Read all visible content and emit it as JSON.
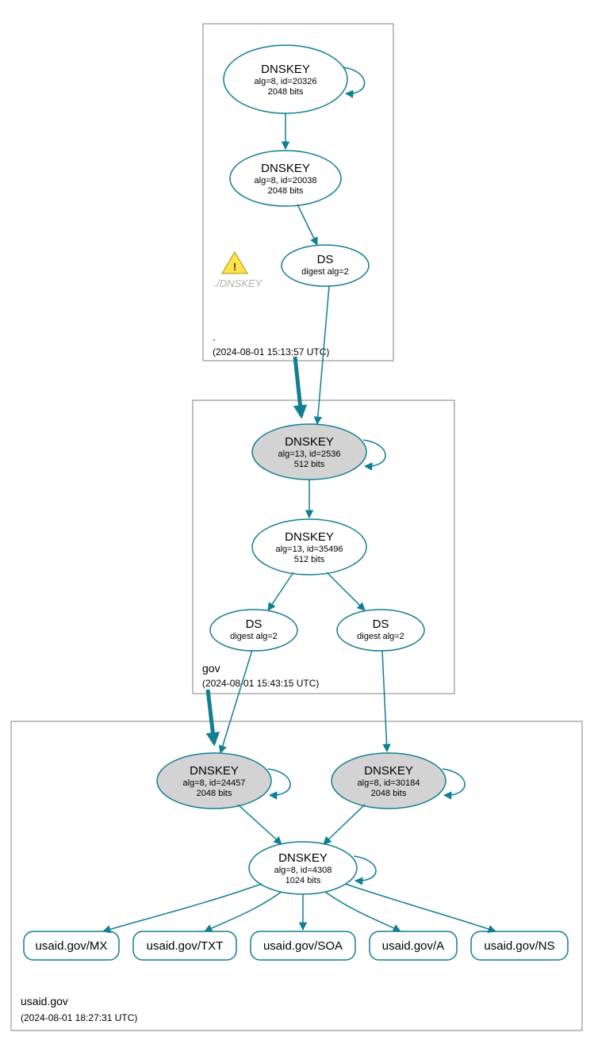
{
  "zones": {
    "root": {
      "name": ".",
      "timestamp": "(2024-08-01 15:13:57 UTC)",
      "nodes": {
        "key1": {
          "title": "DNSKEY",
          "line2": "alg=8, id=20326",
          "line3": "2048 bits"
        },
        "key2": {
          "title": "DNSKEY",
          "line2": "alg=8, id=20038",
          "line3": "2048 bits"
        },
        "ds": {
          "title": "DS",
          "line2": "digest alg=2"
        },
        "ghost": {
          "label": "./DNSKEY"
        }
      }
    },
    "gov": {
      "name": "gov",
      "timestamp": "(2024-08-01 15:43:15 UTC)",
      "nodes": {
        "key1": {
          "title": "DNSKEY",
          "line2": "alg=13, id=2536",
          "line3": "512 bits"
        },
        "key2": {
          "title": "DNSKEY",
          "line2": "alg=13, id=35496",
          "line3": "512 bits"
        },
        "ds1": {
          "title": "DS",
          "line2": "digest alg=2"
        },
        "ds2": {
          "title": "DS",
          "line2": "digest alg=2"
        }
      }
    },
    "usaid": {
      "name": "usaid.gov",
      "timestamp": "(2024-08-01 18:27:31 UTC)",
      "nodes": {
        "key1": {
          "title": "DNSKEY",
          "line2": "alg=8, id=24457",
          "line3": "2048 bits"
        },
        "key2": {
          "title": "DNSKEY",
          "line2": "alg=8, id=30184",
          "line3": "2048 bits"
        },
        "key3": {
          "title": "DNSKEY",
          "line2": "alg=8, id=4308",
          "line3": "1024 bits"
        },
        "rrset": {
          "mx": "usaid.gov/MX",
          "txt": "usaid.gov/TXT",
          "soa": "usaid.gov/SOA",
          "a": "usaid.gov/A",
          "ns": "usaid.gov/NS"
        }
      }
    }
  }
}
